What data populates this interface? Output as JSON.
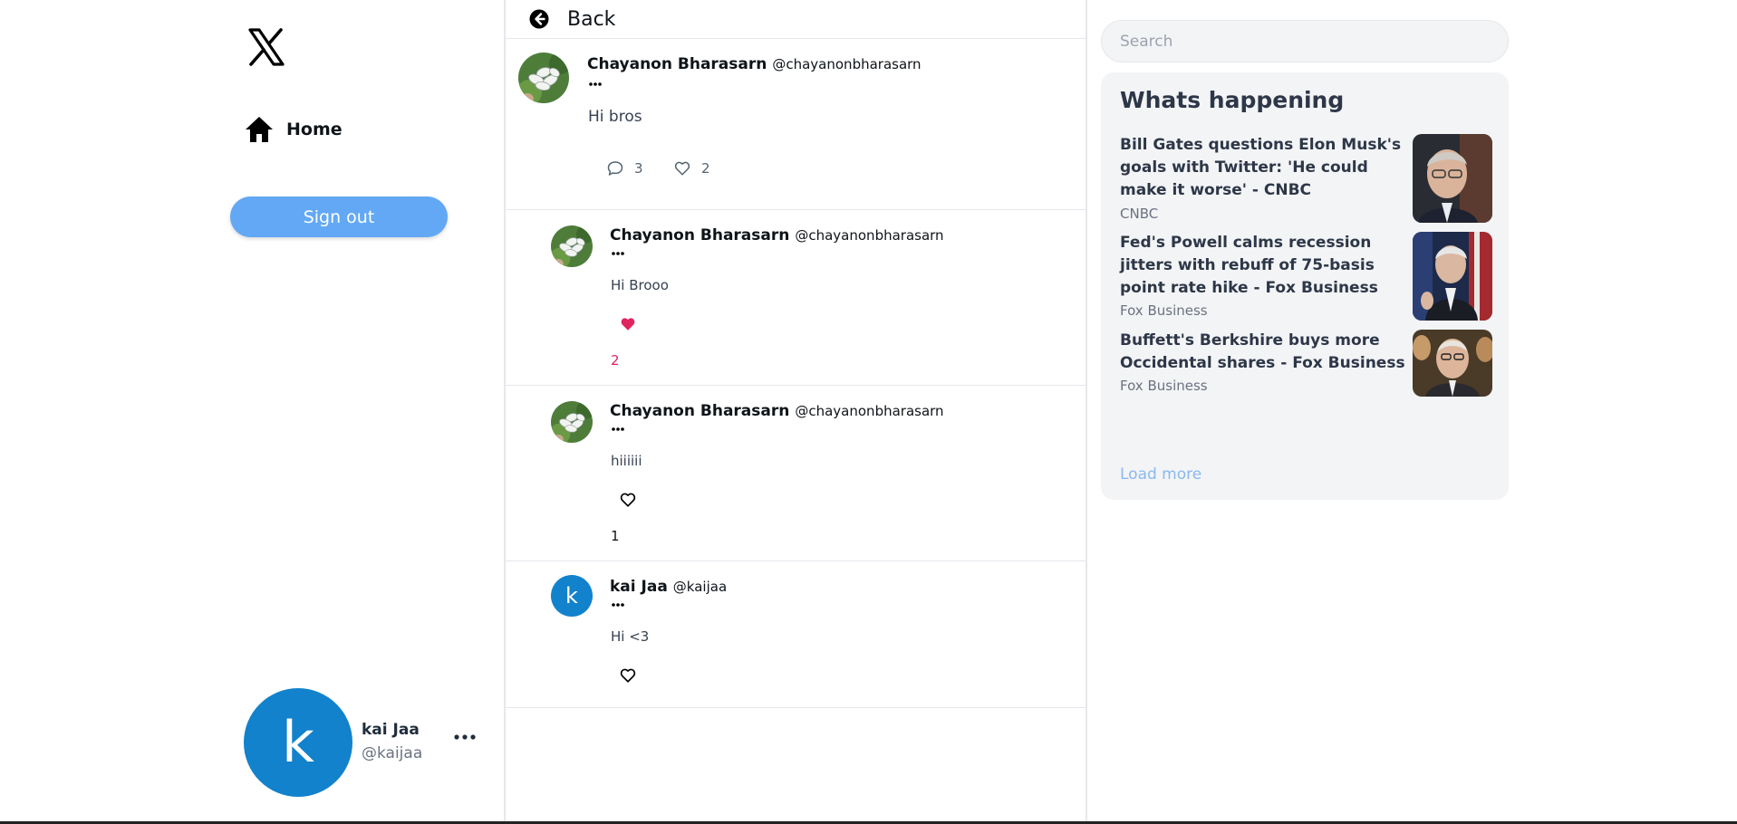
{
  "sidebar": {
    "logo_icon": "x-logo-icon",
    "home_icon": "home-icon",
    "home_label": "Home",
    "signout_label": "Sign out",
    "profile": {
      "avatar_letter": "k",
      "name": "kai Jaa",
      "handle": "@kaijaa"
    }
  },
  "main": {
    "back_icon": "arrow-left-circle-icon",
    "back_label": "Back",
    "post": {
      "name": "Chayanon Bharasarn",
      "handle": "@chayanonbharasarn",
      "text": "Hi bros",
      "comment_count": "3",
      "like_count": "2"
    },
    "replies": [
      {
        "name": "Chayanon Bharasarn",
        "handle": "@chayanonbharasarn",
        "text": "Hi Brooo",
        "liked": true,
        "like_count": "2"
      },
      {
        "name": "Chayanon Bharasarn",
        "handle": "@chayanonbharasarn",
        "text": "hiiiiii",
        "liked": false,
        "like_count": "1"
      },
      {
        "name": "kai Jaa",
        "handle": "@kaijaa",
        "text": "Hi <3",
        "liked": false,
        "avatar_letter": "k"
      }
    ]
  },
  "right": {
    "search_placeholder": "Search",
    "trends_title": "Whats happening",
    "trends": [
      {
        "headline": "Bill Gates questions Elon Musk's goals with Twitter: 'He could make it worse' - CNBC",
        "source": "CNBC"
      },
      {
        "headline": "Fed's Powell calms recession jitters with rebuff of 75-basis point rate hike - Fox Business",
        "source": "Fox Business"
      },
      {
        "headline": "Buffett's Berkshire buys more Occidental shares - Fox Business",
        "source": "Fox Business"
      }
    ],
    "load_more": "Load more"
  },
  "colors": {
    "accent": "#62a8f5",
    "avatar_blue": "#1282cc",
    "like_red": "#e0245e",
    "panel_bg": "#f3f4f6"
  }
}
